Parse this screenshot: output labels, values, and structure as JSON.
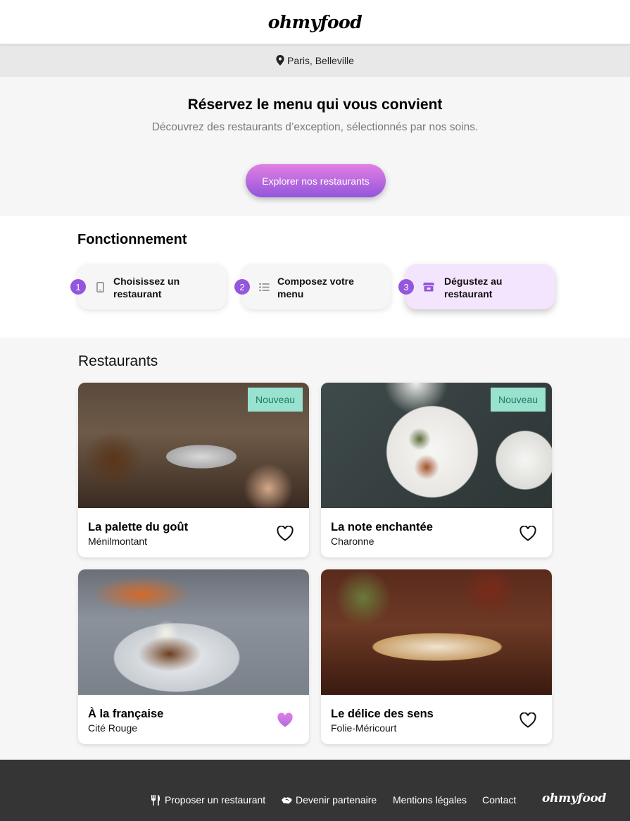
{
  "header": {
    "logo": "ohmyfood"
  },
  "location": {
    "icon": "map-pin-icon",
    "text": "Paris, Belleville"
  },
  "hero": {
    "title": "Réservez le menu qui vous convient",
    "subtitle": "Découvrez des restaurants d’exception, sélectionnés par nos soins.",
    "button": "Explorer nos restaurants"
  },
  "how": {
    "title": "Fonctionnement",
    "steps": [
      {
        "number": "1",
        "icon": "mobile-phone-icon",
        "label": "Choisissez un restaurant"
      },
      {
        "number": "2",
        "icon": "list-icon",
        "label": "Composez votre menu"
      },
      {
        "number": "3",
        "icon": "store-icon",
        "label": "Dégustez au restaurant"
      }
    ]
  },
  "restaurants": {
    "title": "Restaurants",
    "cards": [
      {
        "name": "La palette du goût",
        "area": "Ménilmontant",
        "badge": "Nouveau",
        "liked": false
      },
      {
        "name": "La note enchantée",
        "area": "Charonne",
        "badge": "Nouveau",
        "liked": false
      },
      {
        "name": "À la française",
        "area": "Cité Rouge",
        "badge": "",
        "liked": true
      },
      {
        "name": "Le délice des sens",
        "area": "Folie-Méricourt",
        "badge": "",
        "liked": false
      }
    ]
  },
  "footer": {
    "links": [
      {
        "icon": "utensils-icon",
        "label": "Proposer un restaurant"
      },
      {
        "icon": "handshake-icon",
        "label": "Devenir partenaire"
      },
      {
        "icon": "",
        "label": "Mentions légales"
      },
      {
        "icon": "",
        "label": "Contact"
      }
    ],
    "logo": "ohmyfood"
  },
  "colors": {
    "primary": "#9356dc",
    "secondary": "#ff79da",
    "badge": "#99e2d0",
    "footer": "#353535"
  }
}
